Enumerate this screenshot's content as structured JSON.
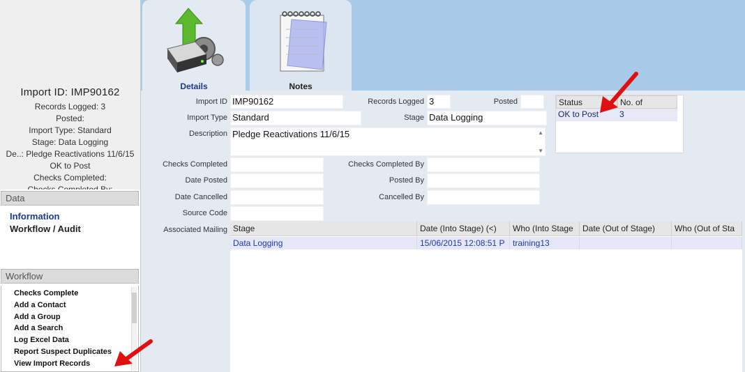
{
  "summary": {
    "title": "Import ID: IMP90162",
    "lines": [
      "Records Logged: 3",
      "Posted:",
      "Import Type: Standard",
      "Stage: Data Logging",
      "De..: Pledge Reactivations 11/6/15",
      "OK to Post",
      "Checks Completed:",
      "Checks Completed By:"
    ]
  },
  "data_section": {
    "heading": "Data",
    "links": [
      "Information",
      "Workflow / Audit"
    ]
  },
  "workflow_section": {
    "heading": "Workflow",
    "items": [
      "Checks Complete",
      "Add a Contact",
      "Add a Group",
      "Add a Search",
      "Log Excel Data",
      "Report Suspect Duplicates",
      "View Import Records"
    ]
  },
  "tabs": [
    {
      "label": "Details",
      "icon": "server-upload-icon"
    },
    {
      "label": "Notes",
      "icon": "notepad-icon"
    }
  ],
  "form": {
    "import_id": {
      "label": "Import ID",
      "value": "IMP90162"
    },
    "records_logged": {
      "label": "Records Logged",
      "value": "3"
    },
    "posted": {
      "label": "Posted",
      "value": ""
    },
    "import_type": {
      "label": "Import Type",
      "value": "Standard"
    },
    "stage": {
      "label": "Stage",
      "value": "Data Logging"
    },
    "description": {
      "label": "Description",
      "value": "Pledge Reactivations 11/6/15"
    },
    "checks_completed": {
      "label": "Checks Completed",
      "value": ""
    },
    "checks_completed_by": {
      "label": "Checks Completed By",
      "value": ""
    },
    "date_posted": {
      "label": "Date Posted",
      "value": ""
    },
    "posted_by": {
      "label": "Posted By",
      "value": ""
    },
    "date_cancelled": {
      "label": "Date Cancelled",
      "value": ""
    },
    "cancelled_by": {
      "label": "Cancelled By",
      "value": ""
    },
    "source_code": {
      "label": "Source Code",
      "value": ""
    },
    "associated_mailing": {
      "label": "Associated Mailing"
    }
  },
  "status_table": {
    "headers": [
      "Status",
      "No. of"
    ],
    "row": [
      "OK to Post",
      "3"
    ]
  },
  "stage_grid": {
    "headers": [
      "Stage",
      "Date (Into Stage) (<)",
      "Who (Into Stage",
      "Date (Out of Stage)",
      "Who (Out of Sta"
    ],
    "row": [
      "Data Logging",
      "15/06/2015 12:08:51 P",
      "training13",
      "",
      ""
    ]
  },
  "colors": {
    "tab_bar": "#a8cbea",
    "form_bg": "#e4eaf2",
    "link_blue": "#1a3a8a",
    "arrow_red": "#e01010"
  }
}
